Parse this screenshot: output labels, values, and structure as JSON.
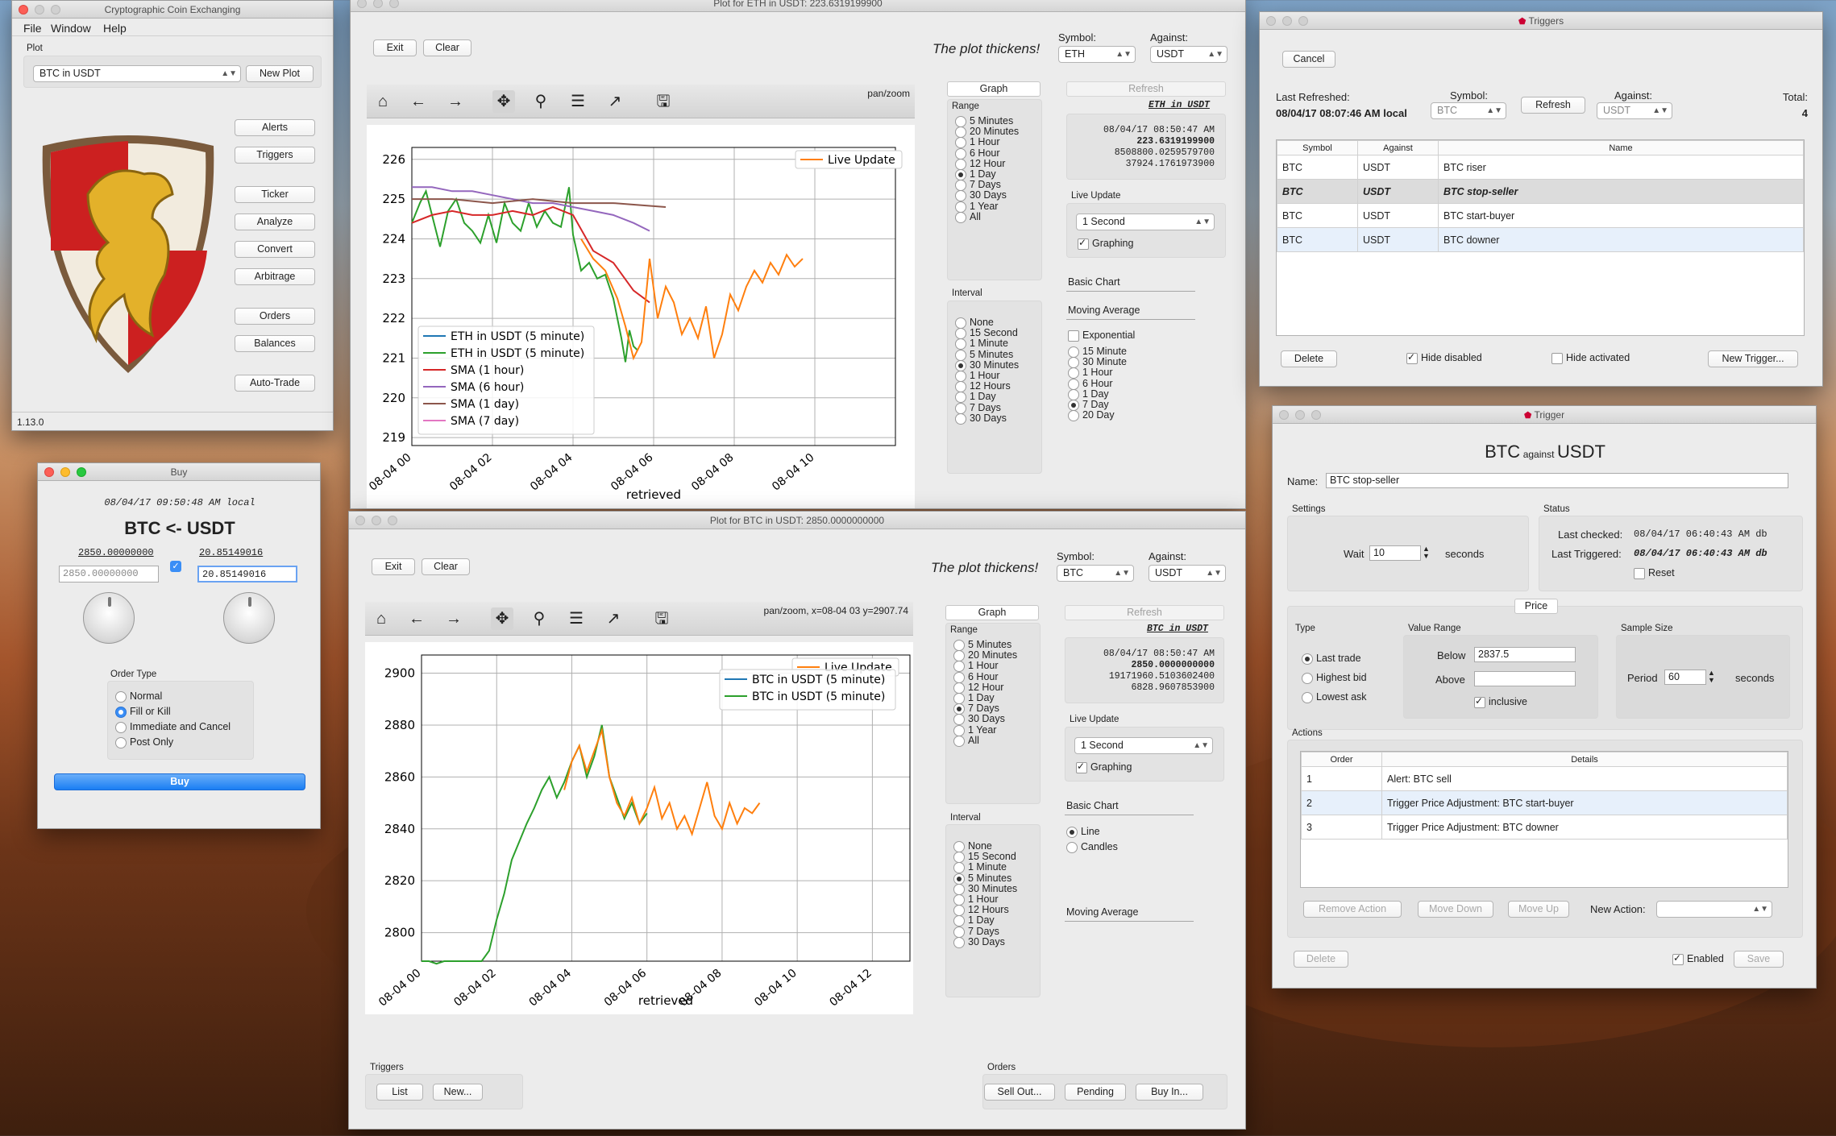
{
  "main": {
    "title": "Cryptographic Coin Exchanging",
    "menu": [
      "File",
      "Window",
      "Help"
    ],
    "section": "Plot",
    "plot_select": "BTC in USDT",
    "new_plot": "New Plot",
    "buttons": [
      "Alerts",
      "Triggers",
      "Ticker",
      "Analyze",
      "Convert",
      "Arbitrage",
      "Orders",
      "Balances",
      "Auto-Trade"
    ],
    "version": "1.13.0"
  },
  "buy": {
    "title": "Buy",
    "timestamp": "08/04/17 09:50:48 AM local",
    "pair": "BTC <- USDT",
    "left_val": "2850.00000000",
    "right_val": "20.85149016",
    "left_input": "2850.00000000",
    "right_input": "20.85149016",
    "order_type_label": "Order Type",
    "order_types": [
      "Normal",
      "Fill or Kill",
      "Immediate and Cancel",
      "Post Only"
    ],
    "selected_order": "Fill or Kill",
    "buy_label": "Buy"
  },
  "plot_eth": {
    "title": "Plot for ETH in USDT: 223.6319199900",
    "exit": "Exit",
    "clear": "Clear",
    "slogan": "The plot thickens!",
    "symbol_label": "Symbol:",
    "symbol": "ETH",
    "against_label": "Against:",
    "against": "USDT",
    "mode": "pan/zoom",
    "graph_tab": "Graph",
    "refresh_tab": "Refresh",
    "range_label": "Range",
    "ranges": [
      "5 Minutes",
      "20 Minutes",
      "1 Hour",
      "6 Hour",
      "12 Hour",
      "1 Day",
      "7 Days",
      "30 Days",
      "1 Year",
      "All"
    ],
    "selected_range": "1 Day",
    "interval_label": "Interval",
    "intervals": [
      "None",
      "15 Second",
      "1 Minute",
      "5 Minutes",
      "30 Minutes",
      "1 Hour",
      "12 Hours",
      "1 Day",
      "7 Days",
      "30 Days"
    ],
    "selected_interval": "30 Minutes",
    "ticker_head": "ETH in USDT",
    "ticker_lines": [
      "08/04/17 08:50:47 AM",
      "223.6319199900",
      "8508800.0259579700",
      "37924.1761973900"
    ],
    "live_update_label": "Live Update",
    "live_update": "1 Second",
    "graphing": "Graphing",
    "basic_chart": "Basic Chart",
    "moving_average": "Moving Average",
    "exponential": "Exponential",
    "ma_options": [
      "15 Minute",
      "30 Minute",
      "1 Hour",
      "6 Hour",
      "1 Day",
      "7 Day",
      "20 Day"
    ],
    "selected_ma": "7 Day"
  },
  "plot_btc": {
    "title": "Plot for BTC in USDT: 2850.0000000000",
    "exit": "Exit",
    "clear": "Clear",
    "slogan": "The plot thickens!",
    "symbol_label": "Symbol:",
    "symbol": "BTC",
    "against_label": "Against:",
    "against": "USDT",
    "mode": "pan/zoom, x=08-04 03 y=2907.74",
    "graph_tab": "Graph",
    "refresh_tab": "Refresh",
    "range_label": "Range",
    "ranges": [
      "5 Minutes",
      "20 Minutes",
      "1 Hour",
      "6 Hour",
      "12 Hour",
      "1 Day",
      "7 Days",
      "30 Days",
      "1 Year",
      "All"
    ],
    "selected_range": "7 Days",
    "interval_label": "Interval",
    "intervals": [
      "None",
      "15 Second",
      "1 Minute",
      "5 Minutes",
      "30 Minutes",
      "1 Hour",
      "12 Hours",
      "1 Day",
      "7 Days",
      "30 Days"
    ],
    "selected_interval": "5 Minutes",
    "ticker_head": "BTC in USDT",
    "ticker_lines": [
      "08/04/17 08:50:47 AM",
      "2850.0000000000",
      "19171960.5103602400",
      "6828.9607853900"
    ],
    "live_update_label": "Live Update",
    "live_update": "1 Second",
    "graphing": "Graphing",
    "basic_chart": "Basic Chart",
    "chart_types": [
      "Line",
      "Candles"
    ],
    "selected_chart": "Line",
    "moving_average": "Moving Average",
    "triggers_label": "Triggers",
    "triggers_buttons": [
      "List",
      "New..."
    ],
    "orders_label": "Orders",
    "orders_buttons": [
      "Sell Out...",
      "Pending",
      "Buy In..."
    ]
  },
  "triggers": {
    "title": "Triggers",
    "cancel": "Cancel",
    "last_refreshed_label": "Last Refreshed:",
    "last_refreshed": "08/04/17 08:07:46 AM local",
    "symbol_label": "Symbol:",
    "symbol": "BTC",
    "refresh": "Refresh",
    "against_label": "Against:",
    "against": "USDT",
    "total_label": "Total:",
    "total": "4",
    "columns": [
      "Symbol",
      "Against",
      "Name"
    ],
    "rows": [
      [
        "BTC",
        "USDT",
        "BTC riser"
      ],
      [
        "BTC",
        "USDT",
        "BTC stop-seller"
      ],
      [
        "BTC",
        "USDT",
        "BTC start-buyer"
      ],
      [
        "BTC",
        "USDT",
        "BTC downer"
      ]
    ],
    "delete": "Delete",
    "hide_disabled": "Hide disabled",
    "hide_activated": "Hide activated",
    "new_trigger": "New Trigger..."
  },
  "trigger": {
    "title": "Trigger",
    "sym": "BTC",
    "against_word": "against",
    "ag": "USDT",
    "name_label": "Name:",
    "name": "BTC stop-seller",
    "settings_label": "Settings",
    "wait_label": "Wait",
    "wait": "10",
    "seconds": "seconds",
    "status_label": "Status",
    "last_checked_label": "Last checked:",
    "last_checked": "08/04/17 06:40:43 AM db",
    "last_triggered_label": "Last Triggered:",
    "last_triggered": "08/04/17 06:40:43 AM db",
    "reset": "Reset",
    "price_tab": "Price",
    "type_label": "Type",
    "types": [
      "Last trade",
      "Highest bid",
      "Lowest ask"
    ],
    "selected_type": "Last trade",
    "value_range_label": "Value Range",
    "below_label": "Below",
    "below": "2837.5",
    "above_label": "Above",
    "above": "",
    "inclusive": "inclusive",
    "sample_size_label": "Sample Size",
    "period_label": "Period",
    "period": "60",
    "actions_label": "Actions",
    "action_cols": [
      "Order",
      "Details"
    ],
    "actions": [
      [
        "1",
        "Alert: BTC sell"
      ],
      [
        "2",
        "Trigger Price Adjustment: BTC start-buyer"
      ],
      [
        "3",
        "Trigger Price Adjustment: BTC downer"
      ]
    ],
    "remove_action": "Remove Action",
    "move_down": "Move Down",
    "move_up": "Move Up",
    "new_action_label": "New Action:",
    "delete": "Delete",
    "enabled": "Enabled",
    "save": "Save"
  },
  "chart_data": [
    {
      "type": "line",
      "xlabel": "retrieved",
      "ylabel": "",
      "ylim": [
        218.8,
        226.3
      ],
      "x_ticks": [
        "08-04 00",
        "08-04 02",
        "08-04 04",
        "08-04 06",
        "08-04 08",
        "08-04 10"
      ],
      "y_ticks": [
        219,
        220,
        221,
        222,
        223,
        224,
        225,
        226
      ],
      "series": [
        {
          "name": "ETH in USDT (5 minute)",
          "color": "#1f77b4",
          "x": [],
          "y": []
        },
        {
          "name": "ETH in USDT (5 minute)",
          "color": "#2ca02c",
          "x": [
            0,
            0.2,
            0.35,
            0.5,
            0.7,
            0.9,
            1.1,
            1.3,
            1.5,
            1.7,
            1.9,
            2.1,
            2.3,
            2.5,
            2.7,
            2.9,
            3.1,
            3.3,
            3.5,
            3.7,
            3.9,
            4.0,
            4.2,
            4.4,
            4.6,
            4.8,
            5.0,
            5.2,
            5.3,
            5.4,
            5.5,
            5.6
          ],
          "y": [
            224.4,
            224.9,
            225.2,
            224.6,
            223.8,
            224.7,
            225.0,
            224.4,
            224.2,
            223.9,
            224.6,
            223.9,
            224.9,
            224.4,
            224.2,
            224.9,
            224.3,
            224.7,
            224.4,
            224.3,
            225.3,
            224.1,
            223.2,
            223.4,
            223.0,
            223.1,
            222.5,
            221.5,
            220.9,
            221.7,
            221.3,
            221.2
          ]
        },
        {
          "name": "SMA (1 hour)",
          "color": "#d62728",
          "x": [
            0,
            0.5,
            1,
            1.5,
            2,
            2.5,
            3,
            3.5,
            4,
            4.5,
            5,
            5.5,
            5.9
          ],
          "y": [
            224.4,
            224.6,
            224.7,
            224.6,
            224.6,
            224.7,
            224.6,
            224.8,
            224.6,
            223.7,
            223.4,
            222.7,
            222.4
          ]
        },
        {
          "name": "SMA (6 hour)",
          "color": "#9467bd",
          "x": [
            0,
            0.5,
            1,
            1.5,
            2,
            2.5,
            3,
            3.5,
            4,
            4.5,
            5,
            5.5,
            5.9
          ],
          "y": [
            225.3,
            225.3,
            225.2,
            225.2,
            225.1,
            225.0,
            224.9,
            224.9,
            224.8,
            224.7,
            224.6,
            224.4,
            224.2
          ]
        },
        {
          "name": "SMA (1 day)",
          "color": "#8c564b",
          "x": [
            0,
            1,
            2,
            3,
            4,
            5,
            6.3
          ],
          "y": [
            225.0,
            225.0,
            224.9,
            225.0,
            224.9,
            224.9,
            224.8
          ]
        },
        {
          "name": "SMA (7 day)",
          "color": "#e377c2",
          "x": [],
          "y": []
        },
        {
          "name": "Live Update",
          "color": "#ff7f0e",
          "x": [
            4.2,
            4.5,
            4.8,
            5.1,
            5.3,
            5.5,
            5.7,
            5.9,
            6.1,
            6.3,
            6.5,
            6.7,
            6.9,
            7.1,
            7.3,
            7.5,
            7.7,
            7.9,
            8.1,
            8.3,
            8.5,
            8.7,
            8.9,
            9.1,
            9.3,
            9.5,
            9.7
          ],
          "y": [
            224.0,
            223.5,
            223.2,
            222.5,
            221.8,
            221.0,
            221.4,
            223.5,
            222.0,
            222.8,
            222.4,
            221.6,
            222.0,
            221.5,
            222.3,
            221.0,
            221.6,
            222.6,
            222.2,
            222.8,
            223.2,
            222.9,
            223.4,
            223.1,
            223.6,
            223.3,
            223.5
          ]
        }
      ]
    },
    {
      "type": "line",
      "xlabel": "retrieved",
      "ylabel": "",
      "ylim": [
        2789,
        2907
      ],
      "x_ticks": [
        "08-04 00",
        "08-04 02",
        "08-04 04",
        "08-04 06",
        "08-04 08",
        "08-04 10",
        "08-04 12"
      ],
      "y_ticks": [
        2800,
        2820,
        2840,
        2860,
        2880,
        2900
      ],
      "series": [
        {
          "name": "BTC in USDT (5 minute)",
          "color": "#1f77b4",
          "x": [],
          "y": []
        },
        {
          "name": "BTC in USDT (5 minute)",
          "color": "#2ca02c",
          "x": [
            0,
            0.2,
            0.4,
            0.6,
            0.8,
            1.0,
            1.2,
            1.4,
            1.6,
            1.8,
            2.0,
            2.2,
            2.4,
            2.6,
            2.8,
            3.0,
            3.2,
            3.4,
            3.6,
            3.8,
            4.0,
            4.2,
            4.4,
            4.6,
            4.8,
            5.0,
            5.2,
            5.4,
            5.6,
            5.8,
            6.0
          ],
          "y": [
            2789,
            2789,
            2788,
            2789,
            2789,
            2789,
            2789,
            2789,
            2789,
            2793,
            2805,
            2815,
            2828,
            2835,
            2842,
            2848,
            2855,
            2860,
            2852,
            2858,
            2866,
            2872,
            2860,
            2868,
            2880,
            2860,
            2852,
            2844,
            2850,
            2842,
            2846
          ]
        },
        {
          "name": "Live Update",
          "color": "#ff7f0e",
          "x": [
            3.8,
            4.0,
            4.2,
            4.4,
            4.6,
            4.8,
            5.0,
            5.2,
            5.4,
            5.6,
            5.8,
            6.0,
            6.2,
            6.4,
            6.6,
            6.8,
            7.0,
            7.2,
            7.4,
            7.6,
            7.8,
            8.0,
            8.2,
            8.4,
            8.6,
            8.8,
            9.0
          ],
          "y": [
            2855,
            2866,
            2872,
            2862,
            2870,
            2878,
            2860,
            2850,
            2845,
            2852,
            2842,
            2848,
            2856,
            2844,
            2850,
            2840,
            2845,
            2838,
            2848,
            2858,
            2845,
            2840,
            2850,
            2842,
            2848,
            2846,
            2850
          ]
        }
      ]
    }
  ]
}
